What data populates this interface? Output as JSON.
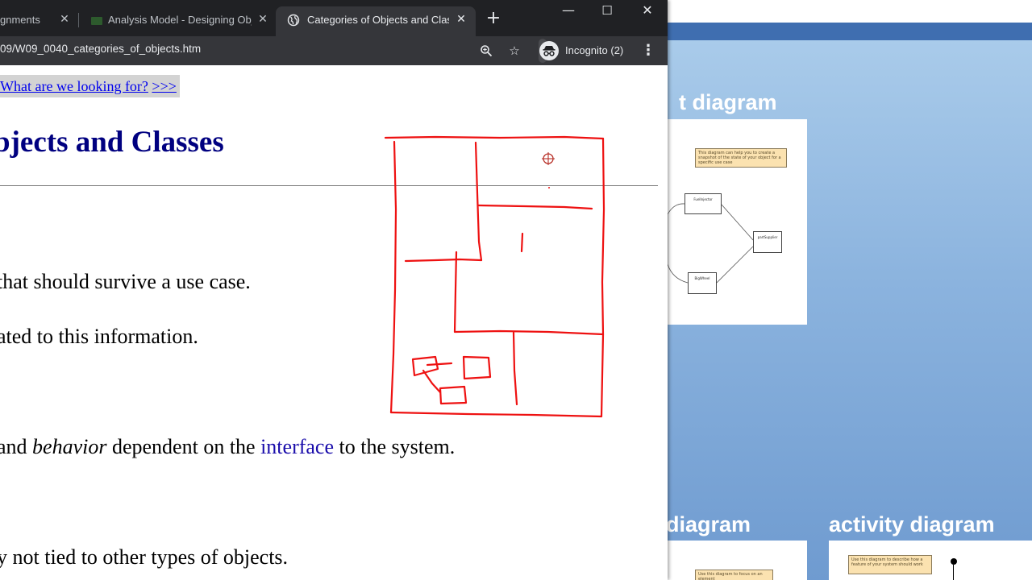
{
  "browser": {
    "tabs": [
      {
        "title": "gnments",
        "active": false
      },
      {
        "title": "Analysis Model - Designing Obj",
        "active": false
      },
      {
        "title": "Categories of Objects and Clas",
        "active": true
      }
    ],
    "new_tab_glyph": "+",
    "window_controls": {
      "minimize": "—",
      "maximize": "☐",
      "close": "✕"
    },
    "url": "09/W09_0040_categories_of_objects.htm",
    "incognito_label": "Incognito (2)",
    "toolbar_icons": [
      "zoom-icon",
      "star-icon",
      "incognito-icon",
      "menu-icon"
    ]
  },
  "page": {
    "nav_link_text": "What are we looking for?",
    "nav_link_arrows": ">>>",
    "heading": "bjects and Classes",
    "lines": {
      "line1": " that should survive a use case.",
      "line2": "ated to this information.",
      "line3_a": " and ",
      "line3_b": "behavior",
      "line3_c": " dependent on the ",
      "line3_link": "interface",
      "line3_d": " to the system.",
      "line4": "y not tied to other types of objects."
    }
  },
  "background_app": {
    "heading_top": "t diagram",
    "heading_left_bottom": "diagram",
    "heading_right_bottom": "activity diagram",
    "diagram_note": "This diagram can help you to create a snapshot of the state of your object for a specific use case",
    "box_labels": [
      "FuelInjector",
      "partSupplier",
      "BigWheel"
    ],
    "note_bottom_left": "Use this diagram to focus on an element",
    "note_bottom_right": "Use this diagram to describe how a feature of your system should work"
  },
  "colors": {
    "heading": "#000080",
    "link": "#0000ee",
    "ink": "#ee1111",
    "chrome_dark": "#202124",
    "chrome_toolbar": "#35363a"
  }
}
